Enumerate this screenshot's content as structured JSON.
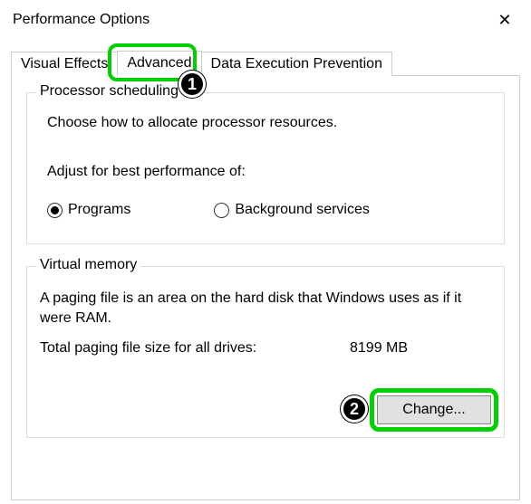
{
  "window": {
    "title": "Performance Options",
    "close_glyph": "✕"
  },
  "tabs": {
    "visual_effects": "Visual Effects",
    "advanced": "Advanced",
    "dep": "Data Execution Prevention"
  },
  "processor_scheduling": {
    "legend": "Processor scheduling",
    "description": "Choose how to allocate processor resources.",
    "adjust_label": "Adjust for best performance of:",
    "option_programs": "Programs",
    "option_background": "Background services"
  },
  "virtual_memory": {
    "legend": "Virtual memory",
    "description": "A paging file is an area on the hard disk that Windows uses as if it were RAM.",
    "total_label": "Total paging file size for all drives:",
    "total_value": "8199 MB",
    "change_button": "Change..."
  },
  "annotations": {
    "badge1": "1",
    "badge2": "2"
  }
}
